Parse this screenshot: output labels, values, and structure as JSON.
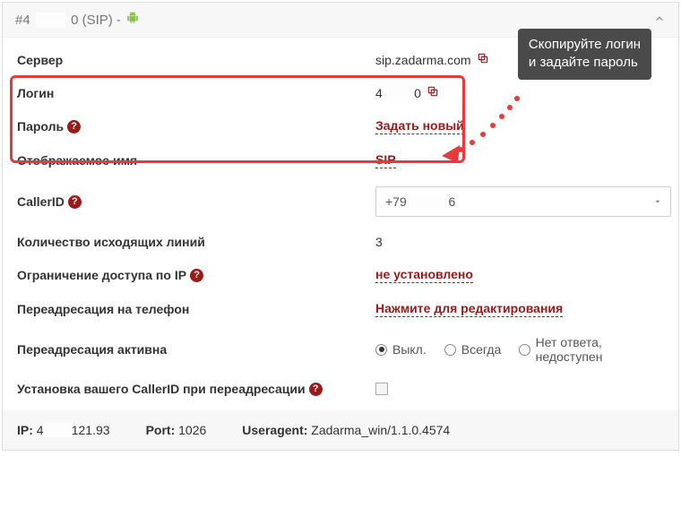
{
  "header": {
    "title_prefix": "#4",
    "title_hidden": "____",
    "title_suffix": "0 (SIP) - "
  },
  "rows": {
    "server": {
      "label": "Сервер",
      "value": "sip.zadarma.com"
    },
    "login": {
      "label": "Логин",
      "value_prefix": "4",
      "value_hidden": "___",
      "value_suffix": "0"
    },
    "password": {
      "label": "Пароль",
      "action": "Задать новый"
    },
    "display_name": {
      "label": "Отображаемое имя",
      "value": "SIP"
    },
    "caller_id": {
      "label": "CallerID",
      "selected_prefix": "+79",
      "selected_hidden": "______",
      "selected_suffix": "6"
    },
    "outgoing_lines": {
      "label": "Количество исходящих линий",
      "value": "3"
    },
    "ip_restriction": {
      "label": "Ограничение доступа по IP",
      "value": "не установлено"
    },
    "forward_phone": {
      "label": "Переадресация на телефон",
      "action": "Нажмите для редактирования"
    },
    "forward_active": {
      "label": "Переадресация активна",
      "options": [
        "Выкл.",
        "Всегда",
        "Нет ответа, недоступен"
      ],
      "selected_index": 0
    },
    "own_callerid": {
      "label": "Установка вашего CallerID при переадресации"
    }
  },
  "tooltip": {
    "line1": "Скопируйте логин",
    "line2": "и задайте пароль"
  },
  "footer": {
    "ip_label": "IP:",
    "ip_prefix": " 4",
    "ip_hidden": "____",
    "ip_suffix": "121.93",
    "port_label": "Port:",
    "port_value": " 1026",
    "ua_label": "Useragent:",
    "ua_value": " Zadarma_win/1.1.0.4574"
  }
}
